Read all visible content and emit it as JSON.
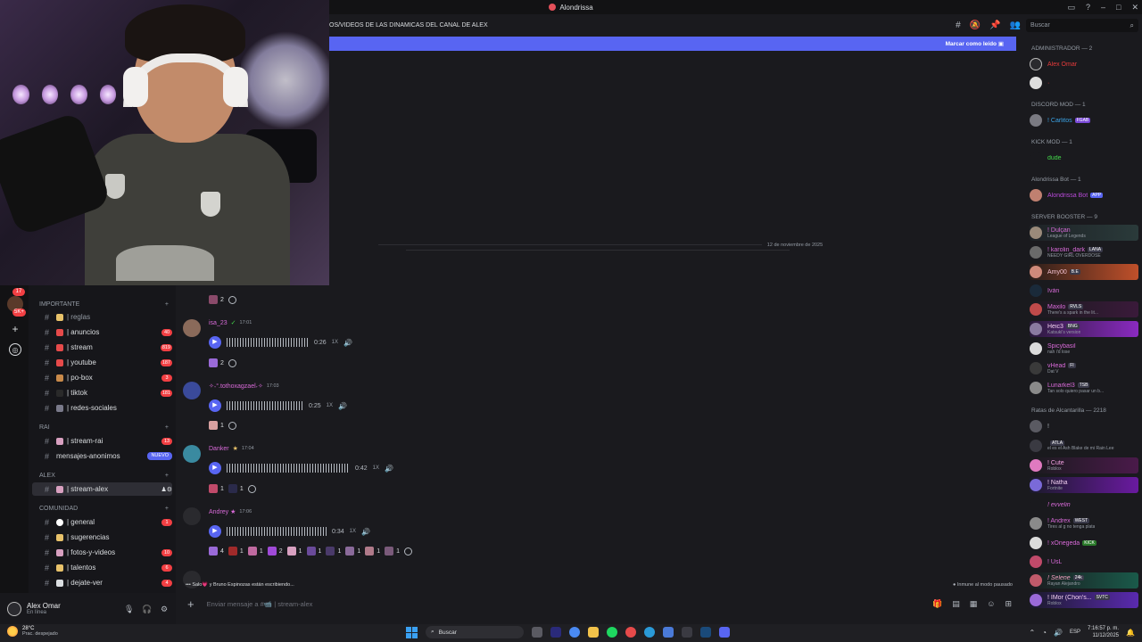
{
  "window": {
    "title": "Alondrissa"
  },
  "header": {
    "channel_topic": "OS/VIDEOS DE LAS DINAMICAS DEL CANAL DE ALEX",
    "banner_label": "Marcar como leído"
  },
  "date_separator": "12 de noviembre de 2025",
  "rail": {
    "badges": [
      "17",
      "5K+"
    ]
  },
  "sidebar": {
    "categories": {
      "importante": "IMPORTANTE",
      "rai": "RAI",
      "alex": "ALEX",
      "comunidad": "COMUNIDAD"
    },
    "channels": [
      {
        "label": "| reglas",
        "count": ""
      },
      {
        "label": "| anuncios",
        "count": "40"
      },
      {
        "label": "| stream",
        "count": "819"
      },
      {
        "label": "| youtube",
        "count": "187"
      },
      {
        "label": "| po-box",
        "count": "3"
      },
      {
        "label": "| tiktok",
        "count": "181"
      },
      {
        "label": "| redes-sociales",
        "count": ""
      },
      {
        "label": "| stream-rai",
        "count": "13"
      },
      {
        "label": "mensajes-anonimos",
        "count": "NUEVO"
      },
      {
        "label": "| stream-alex",
        "count": ""
      },
      {
        "label": "| general",
        "count": "1"
      },
      {
        "label": "| sugerencias",
        "count": ""
      },
      {
        "label": "| fotos-y-videos",
        "count": "10"
      },
      {
        "label": "| talentos",
        "count": "6"
      },
      {
        "label": "| dejate-ver",
        "count": "4"
      }
    ]
  },
  "user": {
    "name": "Alex Omar",
    "status": "En línea"
  },
  "messages": [
    {
      "author": "isa_23",
      "time": "17:01",
      "duration": "0:26",
      "speed": "1X",
      "reactions": [
        "2"
      ]
    },
    {
      "author": "✧˖°.tothoxagzael˖✧",
      "time": "17:03",
      "duration": "0:25",
      "speed": "1X",
      "reactions": [
        "1"
      ]
    },
    {
      "author": "Danker",
      "time": "17:04",
      "duration": "0:42",
      "speed": "1X",
      "reactions": [
        "1",
        "1"
      ]
    },
    {
      "author": "Andrey ★",
      "time": "17:06",
      "duration": "0:34",
      "speed": "1X",
      "reactions": [
        "4",
        "1",
        "1",
        "2",
        "1",
        "1",
        "1",
        "1",
        "1",
        "1"
      ]
    }
  ],
  "first_reaction_count": "2",
  "typing": "Salo💗 y Bruno Espinozas están escribiendo...",
  "paused": "Inmune al modo pausado",
  "composer": {
    "placeholder": "Enviar mensaje a #📹 | stream-alex"
  },
  "search": {
    "placeholder": "Buscar"
  },
  "member_groups": [
    {
      "name": "ADMINISTRADOR — 2"
    },
    {
      "name": "DISCORD MOD — 1"
    },
    {
      "name": "KICK MOD — 1"
    },
    {
      "name": "Alondrissa Bot — 1"
    },
    {
      "name": "SERVER BOOSTER — 9"
    },
    {
      "name": "Ratas de Alcantarilla — 2218"
    }
  ],
  "members": [
    {
      "name": "Alex Omar",
      "sub": "",
      "tag": "",
      "color": "#e63b3b"
    },
    {
      "name": "! Carlitos",
      "sub": "",
      "tag": "FGAB",
      "color": "#3ba3e6"
    },
    {
      "name": "dude",
      "sub": "",
      "tag": "",
      "color": "#43d84a"
    },
    {
      "name": "Alondrissa Bot",
      "sub": "",
      "tag": "APP",
      "color": "#b84ad8"
    },
    {
      "name": "! Dulçan",
      "sub": "League of Legends",
      "tag": "",
      "color": "#d86ad8"
    },
    {
      "name": "! karolin_dark",
      "sub": "NEEDY GIRL OVERDOSE",
      "tag": "LANA",
      "color": "#d86ad8"
    },
    {
      "name": "Amy00",
      "sub": "",
      "tag": "B.E",
      "color": "#d86ad8"
    },
    {
      "name": "Iván",
      "sub": "",
      "tag": "",
      "color": "#d86ad8"
    },
    {
      "name": "Maxilo",
      "sub": "There's a spark in the lit...",
      "tag": "RVLS",
      "color": "#d86ad8"
    },
    {
      "name": "Heic3",
      "sub": "Katsuki's version",
      "tag": "BNG",
      "color": "#d86ad8"
    },
    {
      "name": "Spicybasil",
      "sub": "nah i'd lose",
      "tag": "",
      "color": "#d86ad8"
    },
    {
      "name": "vHead",
      "sub": "Dat V",
      "tag": "FI",
      "color": "#d86ad8"
    },
    {
      "name": "Lunarkel3",
      "sub": "Tan solo quiero pasar un b...",
      "tag": "TSB",
      "color": "#d86ad8"
    },
    {
      "name": "!",
      "sub": "",
      "tag": "",
      "color": "#b5bac1"
    },
    {
      "name": "",
      "sub": "el es el Ash Blake de mi Rain Lee",
      "tag": "ATLA",
      "color": "#dbdee1"
    },
    {
      "name": "! Cute",
      "sub": "Roblox",
      "tag": "",
      "color": "#d86ad8"
    },
    {
      "name": "! Natha",
      "sub": "Fortnite",
      "tag": "",
      "color": "#d86ad8"
    },
    {
      "name": "! evvelin",
      "sub": "",
      "tag": "",
      "color": "#d86ad8"
    },
    {
      "name": "! Andrex",
      "sub": "Tires al g no tenga plata",
      "tag": "WEST",
      "color": "#d86ad8"
    },
    {
      "name": "! xOnegeda",
      "sub": "",
      "tag": "KICK",
      "color": "#d86ad8"
    },
    {
      "name": "! UsL",
      "sub": "",
      "tag": "",
      "color": "#d86ad8"
    },
    {
      "name": "! Selene",
      "sub": "Rayan Alejandro",
      "tag": "24k",
      "color": "#d86ad8"
    },
    {
      "name": "! IMor (Chon's...",
      "sub": "Roblox",
      "tag": "SVTC",
      "color": "#d86ad8"
    }
  ],
  "taskbar": {
    "temp": "28°C",
    "weather": "Prac. despejado",
    "search": "Buscar",
    "lang": "ESP",
    "time": "7:16:57 p. m.",
    "date": "11/12/2025"
  }
}
